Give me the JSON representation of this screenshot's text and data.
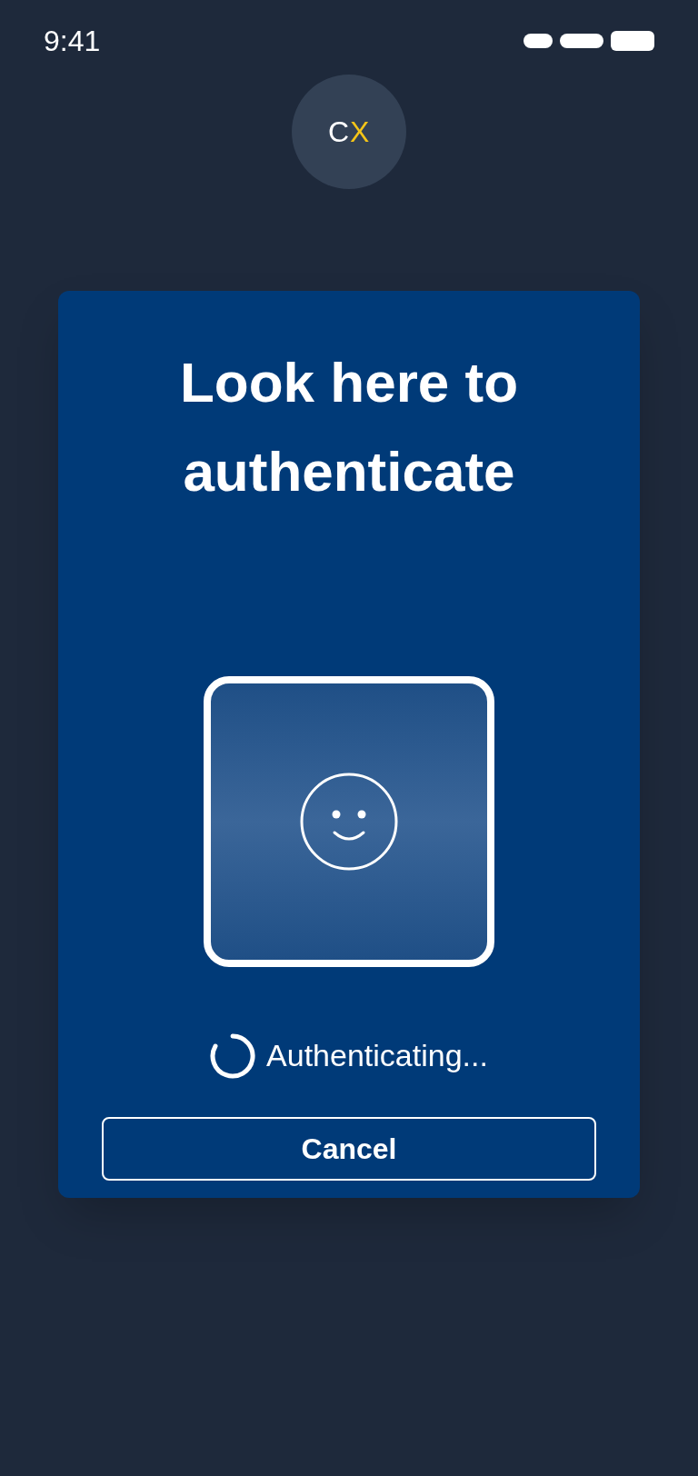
{
  "status_bar": {
    "time": "9:41"
  },
  "logo": {
    "letters": [
      {
        "text": "C",
        "color": "#ffffff"
      },
      {
        "text": "X",
        "color": "#f5c518"
      }
    ]
  },
  "card": {
    "title": "Look here to authenticate",
    "status": "Authenticating...",
    "cancel_button": "Cancel"
  }
}
